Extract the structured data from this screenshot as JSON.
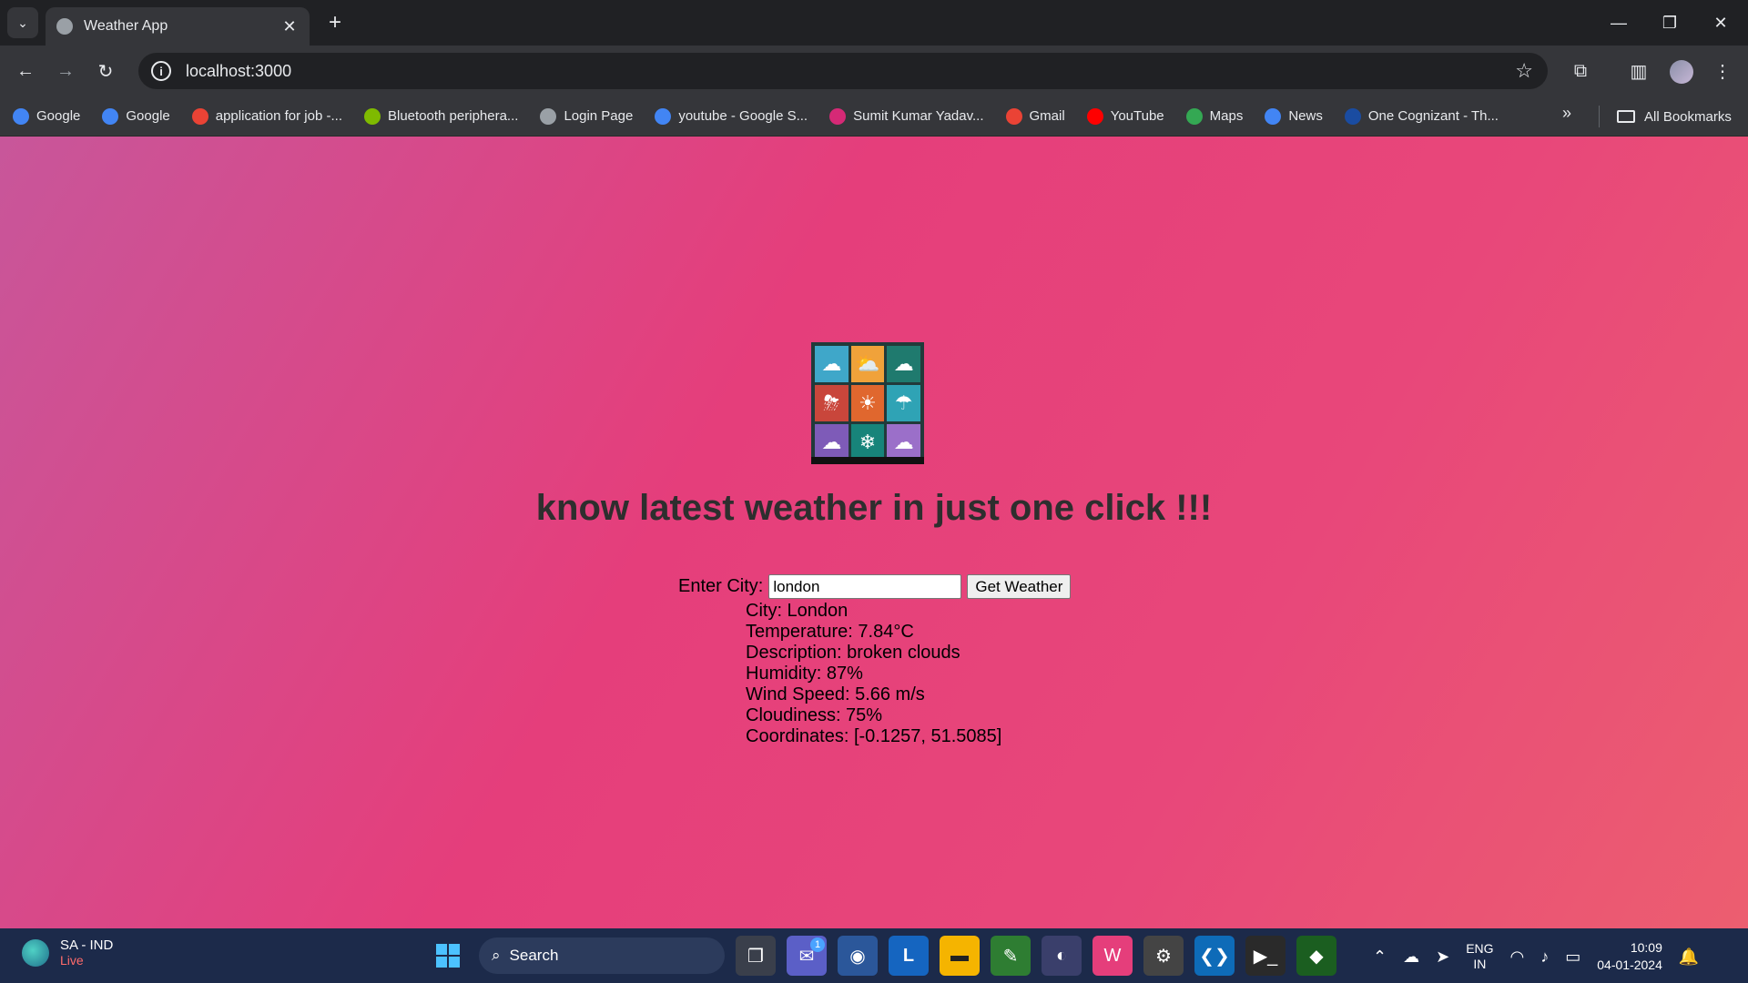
{
  "browser": {
    "tab_title": "Weather App",
    "url": "localhost:3000",
    "bookmarks": [
      {
        "label": "Google",
        "icon": "google-icon",
        "color": "#4285f4"
      },
      {
        "label": "Google",
        "icon": "google-icon",
        "color": "#4285f4"
      },
      {
        "label": "application for job -...",
        "icon": "gmail-icon",
        "color": "#ea4335"
      },
      {
        "label": "Bluetooth periphera...",
        "icon": "microsoft-icon",
        "color": "#7fba00"
      },
      {
        "label": "Login Page",
        "icon": "globe-icon",
        "color": "#9aa0a6"
      },
      {
        "label": "youtube - Google S...",
        "icon": "google-icon",
        "color": "#4285f4"
      },
      {
        "label": "Sumit Kumar Yadav...",
        "icon": "instagram-icon",
        "color": "#d62976"
      },
      {
        "label": "Gmail",
        "icon": "gmail-icon",
        "color": "#ea4335"
      },
      {
        "label": "YouTube",
        "icon": "youtube-icon",
        "color": "#ff0000"
      },
      {
        "label": "Maps",
        "icon": "maps-icon",
        "color": "#34a853"
      },
      {
        "label": "News",
        "icon": "news-icon",
        "color": "#4285f4"
      },
      {
        "label": "One Cognizant - Th...",
        "icon": "cognizant-icon",
        "color": "#1a4ca1"
      }
    ],
    "all_bookmarks": "All Bookmarks"
  },
  "page": {
    "heading": "know latest weather in just one click !!!",
    "enter_city_label": "Enter City:",
    "city_value": "london",
    "button_label": "Get Weather",
    "results": [
      "City: London",
      "Temperature: 7.84°C",
      "Description: broken clouds",
      "Humidity: 87%",
      "Wind Speed: 5.66 m/s",
      "Cloudiness: 75%",
      "Coordinates: [-0.1257, 51.5085]"
    ]
  },
  "taskbar": {
    "widget_title": "SA - IND",
    "widget_sub": "Live",
    "search_label": "Search",
    "chat_badge": "1",
    "lang_top": "ENG",
    "lang_bottom": "IN",
    "time": "10:09",
    "date": "04-01-2024"
  }
}
